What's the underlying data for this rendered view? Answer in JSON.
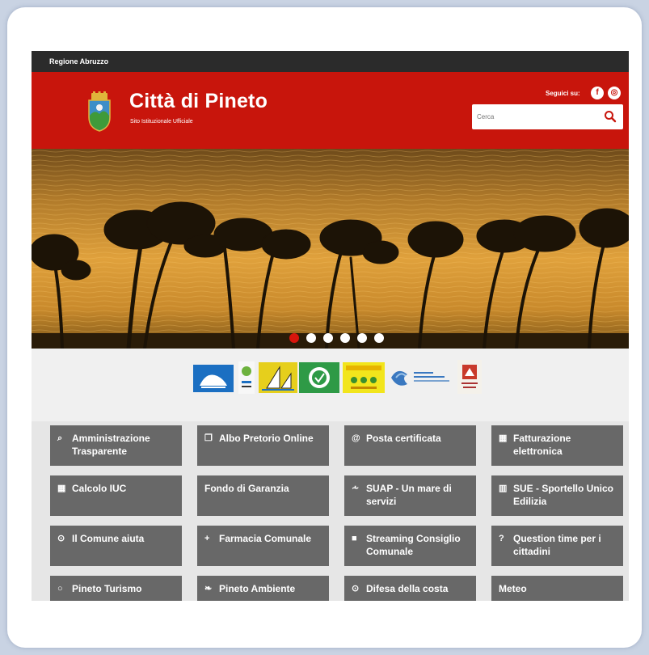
{
  "topbar": {
    "label": "Regione Abruzzo"
  },
  "header": {
    "title": "Città di Pineto",
    "subtitle": "Sito Istituzionale Ufficiale",
    "follow_label": "Seguici su:",
    "social": [
      {
        "name": "facebook",
        "glyph": "f"
      },
      {
        "name": "rss",
        "glyph": "◎"
      }
    ],
    "search": {
      "placeholder": "Cerca"
    }
  },
  "hero": {
    "slides": 6,
    "active_slide": 1
  },
  "colors": {
    "header_red": "#c8150c",
    "tile_gray": "#686868",
    "topbar": "#2b2b2b"
  },
  "tiles": [
    {
      "icon": "search-icon",
      "glyph": "⌕",
      "label": "Amministrazione Trasparente"
    },
    {
      "icon": "document-icon",
      "glyph": "❐",
      "label": "Albo Pretorio Online"
    },
    {
      "icon": "at-icon",
      "glyph": "@",
      "label": "Posta certificata"
    },
    {
      "icon": "calculator-icon",
      "glyph": "▦",
      "label": "Fatturazione elettronica"
    },
    {
      "icon": "calculator-icon",
      "glyph": "▦",
      "label": "Calcolo IUC"
    },
    {
      "icon": "",
      "glyph": "",
      "label": "Fondo di Garanzia"
    },
    {
      "icon": "share-icon",
      "glyph": "⩪",
      "label": "SUAP - Un mare di servizi"
    },
    {
      "icon": "book-icon",
      "glyph": "▥",
      "label": "SUE - Sportello Unico Edilizia"
    },
    {
      "icon": "lifebuoy-icon",
      "glyph": "⊙",
      "label": "Il Comune aiuta"
    },
    {
      "icon": "plus-icon",
      "glyph": "+",
      "label": "Farmacia Comunale"
    },
    {
      "icon": "video-icon",
      "glyph": "■",
      "label": "Streaming Consiglio Comunale"
    },
    {
      "icon": "question-icon",
      "glyph": "?",
      "label": "Question time per i cittadini"
    },
    {
      "icon": "circle-icon",
      "glyph": "○",
      "label": "Pineto Turismo"
    },
    {
      "icon": "leaf-icon",
      "glyph": "❧",
      "label": "Pineto Ambiente"
    },
    {
      "icon": "lifebuoy-icon",
      "glyph": "⊙",
      "label": "Difesa della costa"
    },
    {
      "icon": "",
      "glyph": "",
      "label": "Meteo"
    }
  ]
}
